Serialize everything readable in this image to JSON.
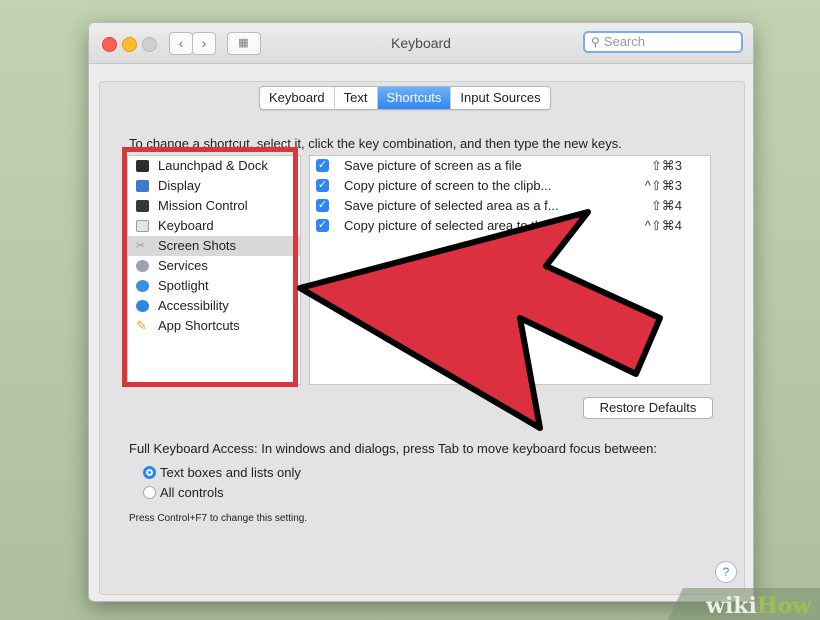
{
  "window": {
    "title": "Keyboard"
  },
  "toolbar": {
    "search_placeholder": "Search",
    "back_icon": "chevron-left-icon",
    "forward_icon": "chevron-right-icon",
    "grid_icon": "grid-icon"
  },
  "tabs": [
    {
      "label": "Keyboard",
      "active": false
    },
    {
      "label": "Text",
      "active": false
    },
    {
      "label": "Shortcuts",
      "active": true
    },
    {
      "label": "Input Sources",
      "active": false
    }
  ],
  "instruction": "To change a shortcut, select it, click the key combination, and then type the new keys.",
  "categories": [
    {
      "label": "Launchpad & Dock",
      "icon": "launchpad-icon"
    },
    {
      "label": "Display",
      "icon": "display-icon"
    },
    {
      "label": "Mission Control",
      "icon": "mission-control-icon"
    },
    {
      "label": "Keyboard",
      "icon": "keyboard-icon"
    },
    {
      "label": "Screen Shots",
      "icon": "screenshot-icon",
      "selected": true
    },
    {
      "label": "Services",
      "icon": "gear-icon"
    },
    {
      "label": "Spotlight",
      "icon": "spotlight-icon"
    },
    {
      "label": "Accessibility",
      "icon": "accessibility-icon"
    },
    {
      "label": "App Shortcuts",
      "icon": "app-shortcuts-icon"
    }
  ],
  "shortcuts": [
    {
      "label": "Save picture of screen as a file",
      "keys": "⇧⌘3",
      "checked": true
    },
    {
      "label": "Copy picture of screen to the clipb...",
      "keys": "^⇧⌘3",
      "checked": true
    },
    {
      "label": "Save picture of selected area as a f...",
      "keys": "⇧⌘4",
      "checked": true
    },
    {
      "label": "Copy picture of selected area to th...",
      "keys": "^⇧⌘4",
      "checked": true
    }
  ],
  "restore_label": "Restore Defaults",
  "full_keyboard_access": {
    "label": "Full Keyboard Access: In windows and dialogs, press Tab to move keyboard focus between:",
    "options": [
      {
        "label": "Text boxes and lists only",
        "selected": true
      },
      {
        "label": "All controls",
        "selected": false
      }
    ],
    "hint": "Press Control+F7 to change this setting."
  },
  "help_label": "?",
  "annotation": {
    "arrow_color": "#dc3040",
    "box_color": "#d9363e"
  },
  "watermark": {
    "part1": "wiki",
    "part2": "How"
  }
}
